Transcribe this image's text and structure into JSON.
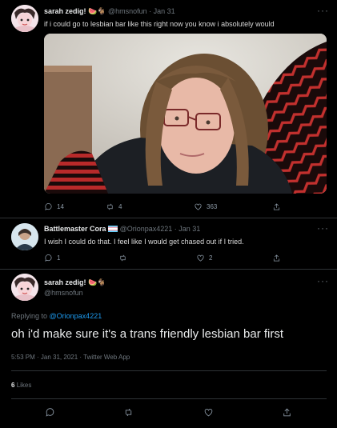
{
  "tweet1": {
    "display_name": "sarah zedig!",
    "name_emojis": "🍉🐐",
    "handle": "@hmsnofun",
    "date": "· Jan 31",
    "text": "if i could go to lesbian bar like this right now you know i absolutely would",
    "more": "···",
    "replies": "14",
    "retweets": "4",
    "likes": "363"
  },
  "tweet2": {
    "display_name": "Battlemaster Cora",
    "handle": "@Orionpax4221",
    "date": "· Jan 31",
    "text": "I wish I could do that. I feel like I would get chased out if I tried.",
    "more": "···",
    "replies": "1",
    "retweets": "",
    "likes": "2"
  },
  "tweet3": {
    "display_name": "sarah zedig!",
    "name_emojis": "🍉🐐",
    "handle": "@hmsnofun",
    "more": "···",
    "replying_prefix": "Replying to ",
    "replying_to": "@Orionpax4221",
    "text": "oh i'd make sure it's a trans friendly lesbian bar first",
    "timestamp": "5:53 PM · Jan 31, 2021 · Twitter Web App",
    "likes_count": "6",
    "likes_label": "Likes"
  },
  "colors": {
    "background": "#000000",
    "link": "#1d9bf0",
    "muted": "#6e767d",
    "divider": "#2f3336"
  }
}
